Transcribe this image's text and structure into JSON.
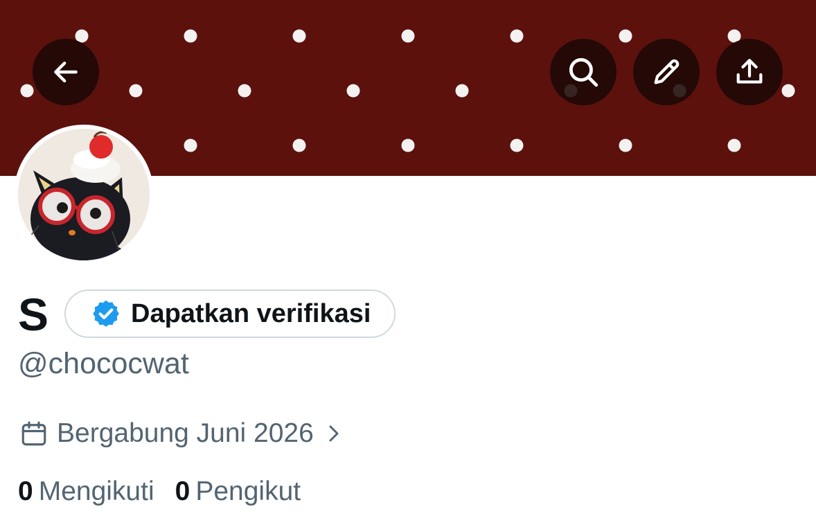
{
  "profile": {
    "display_name": "S",
    "verify_label": "Dapatkan verifikasi",
    "handle": "@chococwat",
    "joined": "Bergabung Juni 2026",
    "following_count": "0",
    "following_label": "Mengikuti",
    "followers_count": "0",
    "followers_label": "Pengikut"
  },
  "colors": {
    "banner": "#5c110d",
    "verified_blue": "#1d9bf0",
    "text_primary": "#0f1419",
    "text_secondary": "#536471"
  },
  "icons": {
    "back": "arrow-left-icon",
    "search": "search-icon",
    "edit": "pencil-icon",
    "share": "share-upload-icon",
    "verified": "verified-badge-icon",
    "calendar": "calendar-icon",
    "chevron": "chevron-right-icon"
  }
}
